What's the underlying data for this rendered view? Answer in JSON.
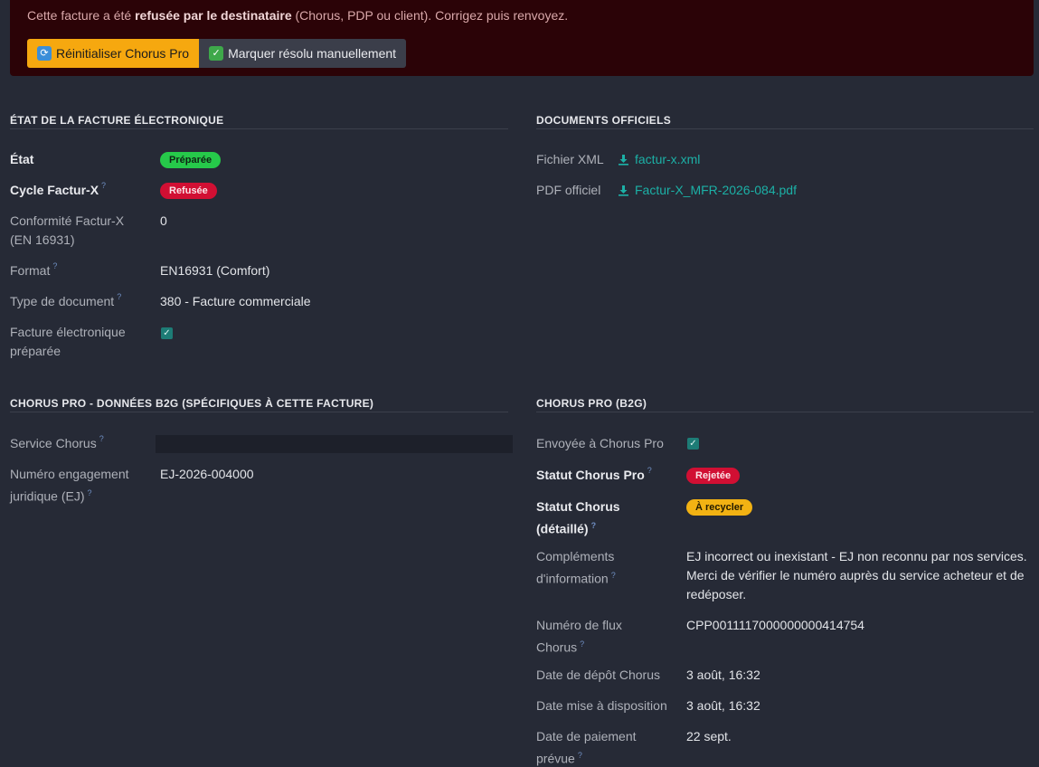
{
  "alert": {
    "text_pre": "Cette facture a été ",
    "text_bold": "refusée par le destinataire",
    "text_post": " (Chorus, PDP ou client). Corrigez puis renvoyez.",
    "reset_button": "Réinitialiser Chorus Pro",
    "resolve_button": "Marquer résolu manuellement",
    "reset_icon": "refresh-emoji",
    "resolve_icon": "check-emoji"
  },
  "einvoice": {
    "title": "ÉTAT DE LA FACTURE ÉLECTRONIQUE",
    "etat_label": "État",
    "etat_value": "Préparée",
    "cycle_label": "Cycle Factur-X",
    "cycle_value": "Refusée",
    "conformite_label_1": "Conformité Factur-X",
    "conformite_label_2": "(EN 16931)",
    "conformite_value": "0",
    "format_label": "Format",
    "format_value": "EN16931 (Comfort)",
    "type_label": "Type de document",
    "type_value": "380 - Facture commerciale",
    "prepared_label_1": "Facture électronique",
    "prepared_label_2": "préparée",
    "prepared_checked": true
  },
  "documents": {
    "title": "DOCUMENTS OFFICIELS",
    "xml_label": "Fichier XML",
    "xml_file": "factur-x.xml",
    "pdf_label": "PDF officiel",
    "pdf_file": "Factur-X_MFR-2026-084.pdf"
  },
  "b2g_data": {
    "title": "CHORUS PRO - DONNÉES B2G (SPÉCIFIQUES À CETTE FACTURE)",
    "service_label": "Service Chorus",
    "service_value": "",
    "ej_label_1": "Numéro engagement",
    "ej_label_2": "juridique (EJ)",
    "ej_value": "EJ-2026-004000"
  },
  "chorus": {
    "title": "CHORUS PRO (B2G)",
    "sent_label": "Envoyée à Chorus Pro",
    "sent_checked": true,
    "status_label": "Statut Chorus Pro",
    "status_value": "Rejetée",
    "status_detail_label_1": "Statut Chorus",
    "status_detail_label_2": "(détaillé)",
    "status_detail_value": "À recycler",
    "complements_label_1": "Compléments",
    "complements_label_2": "d'information",
    "complements_line_1": "EJ incorrect ou inexistant - EJ non reconnu par nos services.",
    "complements_line_2": "Merci de vérifier le numéro auprès du service acheteur et de",
    "complements_line_3": "redéposer.",
    "flux_label_1": "Numéro de flux",
    "flux_label_2": "Chorus",
    "flux_value": "CPP0011117000000000414754",
    "depot_label": "Date de dépôt Chorus",
    "depot_value": "3 août, 16:32",
    "dispo_label": "Date mise à disposition",
    "dispo_value": "3 août, 16:32",
    "paiement_label_1": "Date de paiement",
    "paiement_label_2": "prévue",
    "paiement_value": "22 sept."
  },
  "colors": {
    "background": "#262a36",
    "alert_bg": "#2b0307",
    "warning": "#f6a80f",
    "link": "#1cb0a6",
    "badge_green": "#26c94a",
    "badge_red": "#d10f33",
    "badge_yellow": "#f2b213"
  },
  "help_marker": "?"
}
